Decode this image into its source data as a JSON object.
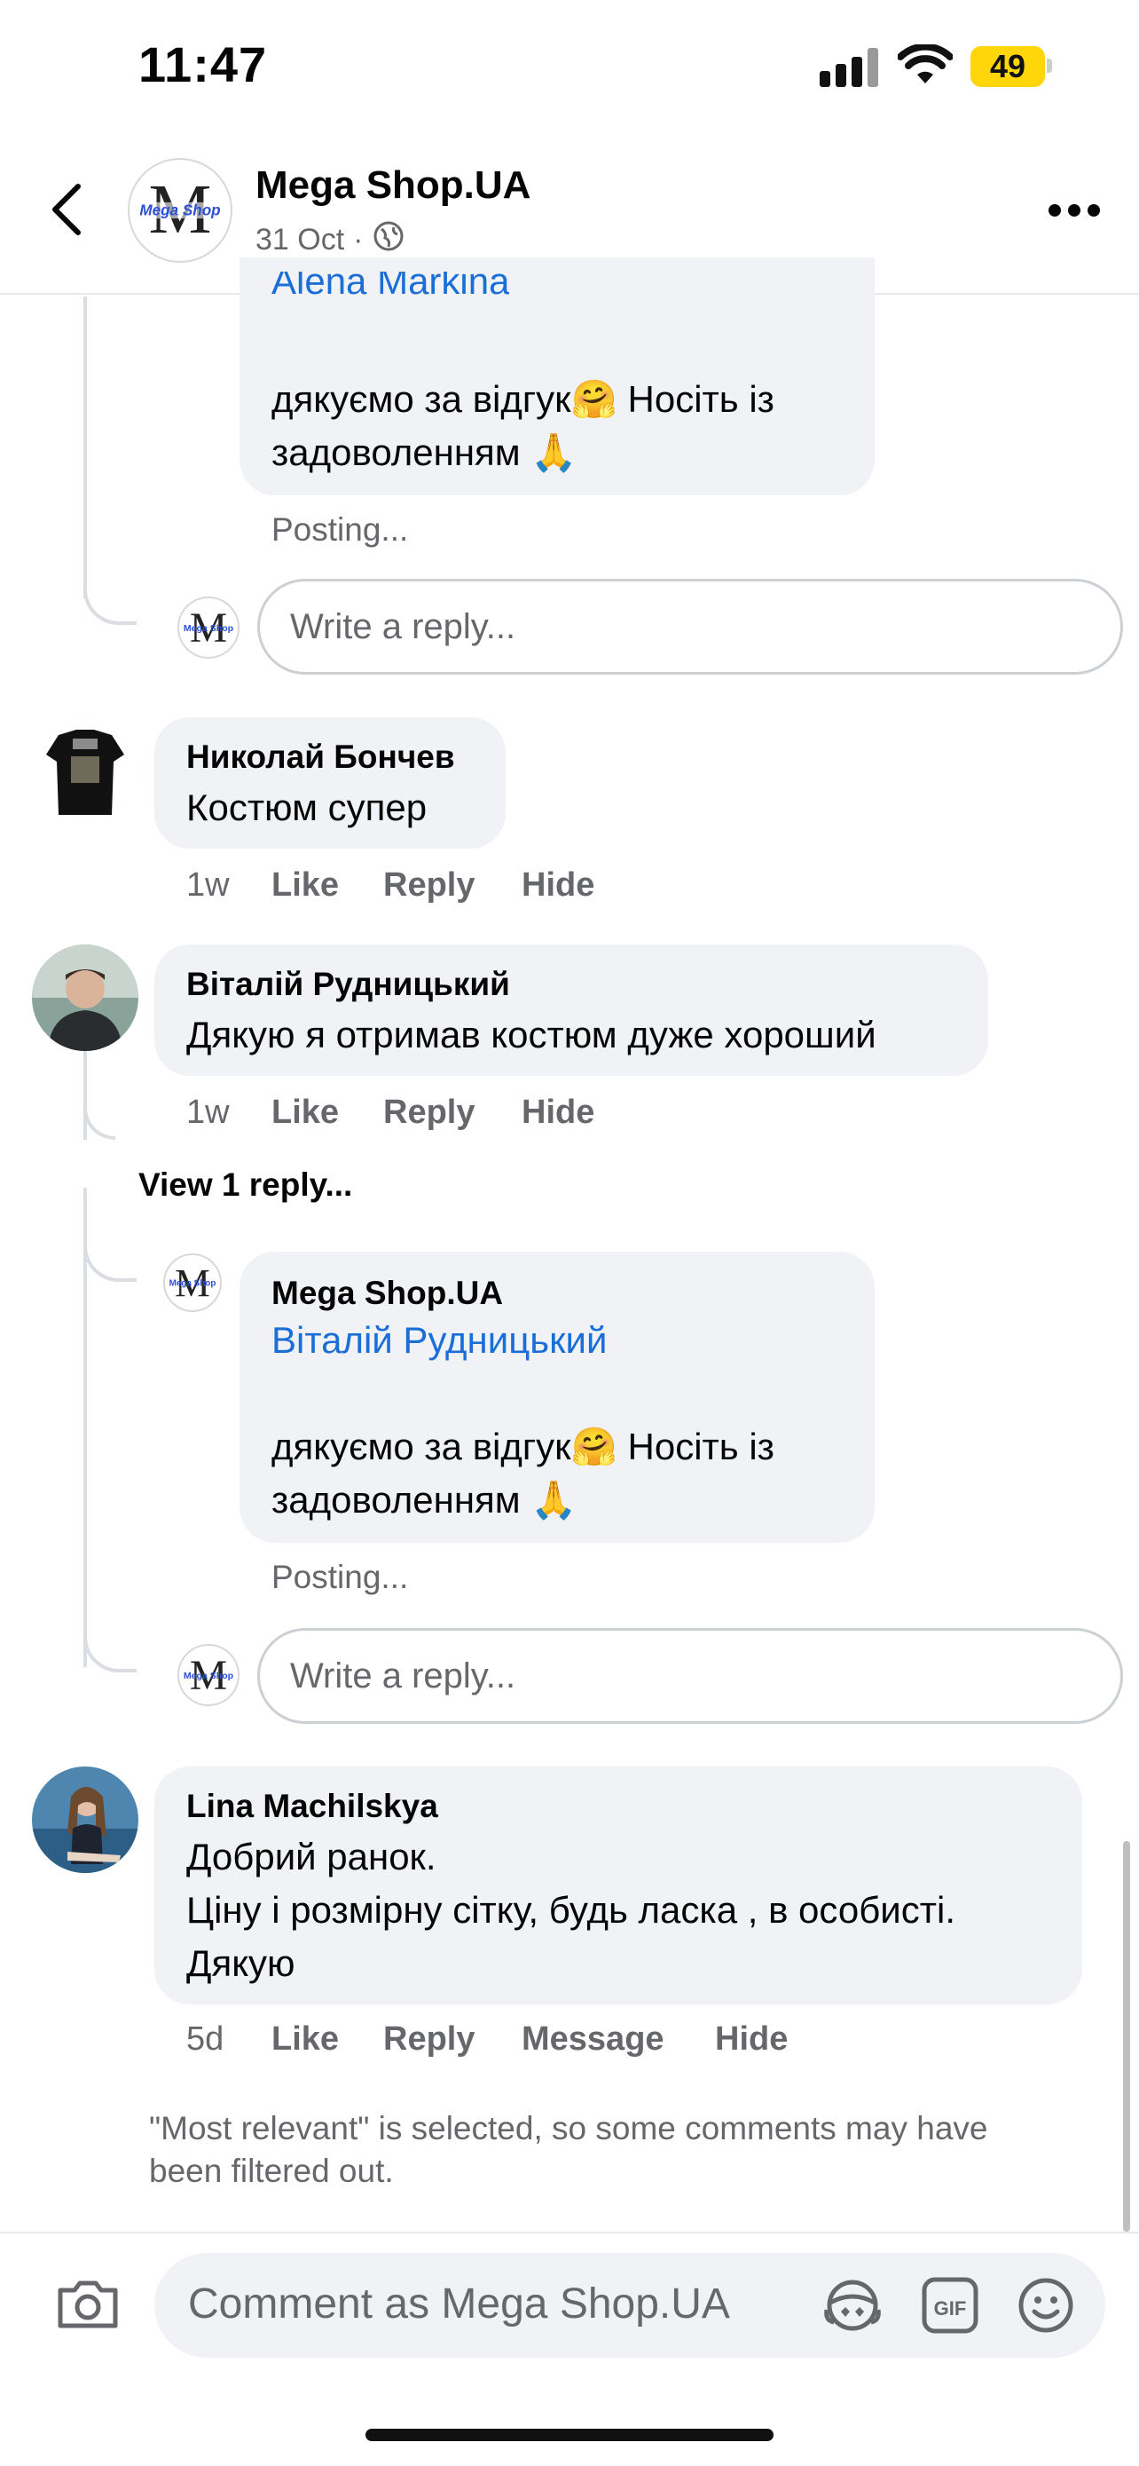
{
  "status": {
    "time": "11:47",
    "battery": "49"
  },
  "header": {
    "title": "Mega Shop.UA",
    "date": "31 Oct",
    "separator": "·"
  },
  "logo_text": "Mega Shop",
  "thread1": {
    "mention": "Alena Markina",
    "text_line1": "дякуємо за відгук🤗 Носіть із",
    "text_line2": "задоволенням 🙏",
    "posting": "Posting...",
    "reply_placeholder": "Write a reply..."
  },
  "comment_nikolay": {
    "author": "Николай Бончев",
    "text": "Костюм супер",
    "time": "1w",
    "like": "Like",
    "reply": "Reply",
    "hide": "Hide"
  },
  "comment_vitaliy": {
    "author": "Віталій Рудницький",
    "text": "Дякую я отримав костюм дуже хороший",
    "time": "1w",
    "like": "Like",
    "reply": "Reply",
    "hide": "Hide",
    "view_replies": "View 1 reply..."
  },
  "reply_mega": {
    "author": "Mega Shop.UA",
    "mention": "Віталій Рудницький",
    "text_line1": "дякуємо за відгук🤗 Носіть із",
    "text_line2": "задоволенням 🙏",
    "posting": "Posting...",
    "reply_placeholder": "Write a reply..."
  },
  "comment_lina": {
    "author": "Lina Machilskya",
    "line1": "Добрий ранок.",
    "line2": "Ціну і розмірну сітку, будь ласка , в особисті.",
    "line3": "Дякую",
    "time": "5d",
    "like": "Like",
    "reply": "Reply",
    "message": "Message",
    "hide": "Hide"
  },
  "filter_note": "\"Most relevant\" is selected, so some comments may have been filtered out.",
  "composer": {
    "placeholder": "Comment as Mega Shop.UA",
    "gif": "GIF"
  },
  "colors": {
    "link": "#1a6ed8",
    "bubble": "#f0f2f5",
    "secondary": "#65676b",
    "battery": "#ffd60a"
  }
}
